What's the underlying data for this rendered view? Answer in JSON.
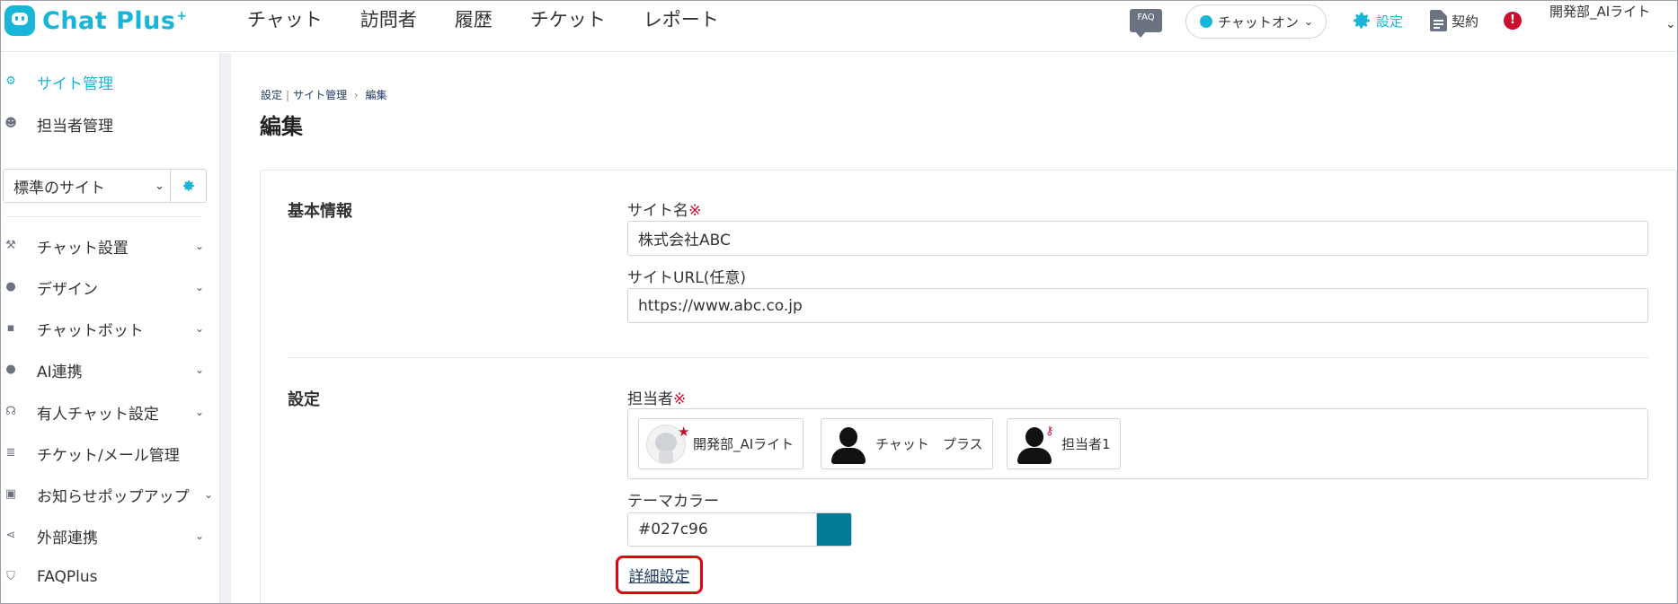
{
  "header": {
    "logo_text": "Chat Plus",
    "logo_sup": "+",
    "nav": [
      "チャット",
      "訪問者",
      "履歴",
      "チケット",
      "レポート"
    ],
    "faq_label": "FAQ",
    "chat_status_label": "チャットオン",
    "settings_label": "設定",
    "contract_label": "契約",
    "alert_symbol": "!",
    "user_name": "開発部_AIライト"
  },
  "sidebar": {
    "top_items": [
      {
        "label": "サイト管理",
        "icon": "gear-icon",
        "active": true
      },
      {
        "label": "担当者管理",
        "icon": "user-gear-icon",
        "active": false
      }
    ],
    "site_select_value": "標準のサイト",
    "menu_items": [
      {
        "label": "チャット設置",
        "icon": "tools-icon"
      },
      {
        "label": "デザイン",
        "icon": "palette-icon"
      },
      {
        "label": "チャットボット",
        "icon": "chat-icon"
      },
      {
        "label": "AI連携",
        "icon": "ai-head-icon"
      },
      {
        "label": "有人チャット設定",
        "icon": "headset-icon"
      },
      {
        "label": "チケット/メール管理",
        "icon": "list-icon"
      },
      {
        "label": "お知らせポップアップ",
        "icon": "popup-icon"
      },
      {
        "label": "外部連携",
        "icon": "share-icon"
      },
      {
        "label": "FAQPlus",
        "icon": "shield-icon"
      }
    ]
  },
  "breadcrumb": {
    "part1": "設定",
    "part2": "サイト管理",
    "part3": "編集"
  },
  "page_title": "編集",
  "basic_info": {
    "section_label": "基本情報",
    "site_name_label": "サイト名",
    "required_mark": "※",
    "site_name_value": "株式会社ABC",
    "site_url_label": "サイトURL(任意)",
    "site_url_value": "https://www.abc.co.jp"
  },
  "settings": {
    "section_label": "設定",
    "staff_label": "担当者",
    "staff": [
      {
        "name": "開発部_AIライト",
        "badge": "star"
      },
      {
        "name": "チャット　プラス",
        "badge": ""
      },
      {
        "name": "担当者1",
        "badge": "key"
      }
    ],
    "theme_color_label": "テーマカラー",
    "theme_color_value": "#027c96",
    "detail_link": "詳細設定"
  },
  "colors": {
    "brand": "#17b5d8",
    "alert": "#c8102e",
    "theme": "#027c96",
    "highlight": "#e60012"
  }
}
